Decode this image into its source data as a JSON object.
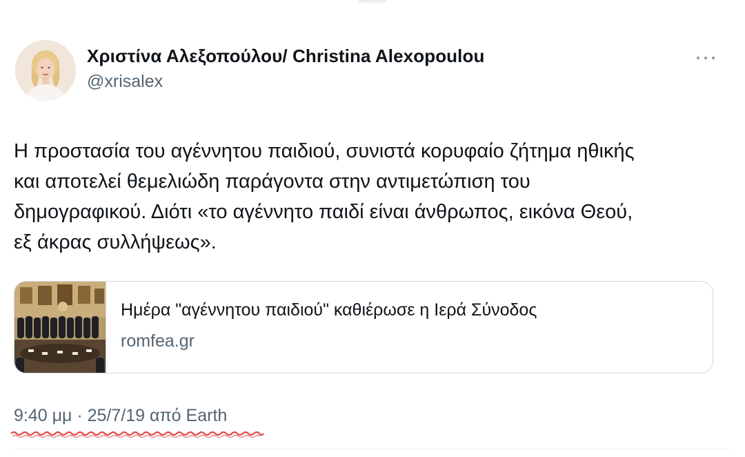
{
  "author": {
    "display_name": "Χριστίνα Αλεξοπούλου/ Christina Alexopoulou",
    "handle": "@xrisalex"
  },
  "tweet": {
    "lines": [
      "Η προστασία του αγέννητου παιδιού, συνιστά κορυφαίο ζήτημα ηθικής",
      "και αποτελεί θεμελιώδη παράγοντα στην αντιμετώπιση του",
      "δημογραφικού. Διότι «το αγέννητο παιδί είναι άνθρωπος, εικόνα Θεού,",
      "εξ άκρας συλλήψεως»."
    ]
  },
  "link_card": {
    "title": "Ημέρα \"αγέννητου παιδιού\" καθιέρωσε η Ιερά Σύνοδος",
    "domain": "romfea.gr"
  },
  "meta": {
    "timestamp": "9:40 μμ · 25/7/19 από Earth"
  },
  "icons": {
    "more": "more-horizontal-icon",
    "annotation": "red-wavy-underline"
  },
  "colors": {
    "text": "#0f1419",
    "secondary_text": "#536471",
    "card_border": "#cfd9de",
    "annotation_red": "#e0484a"
  }
}
